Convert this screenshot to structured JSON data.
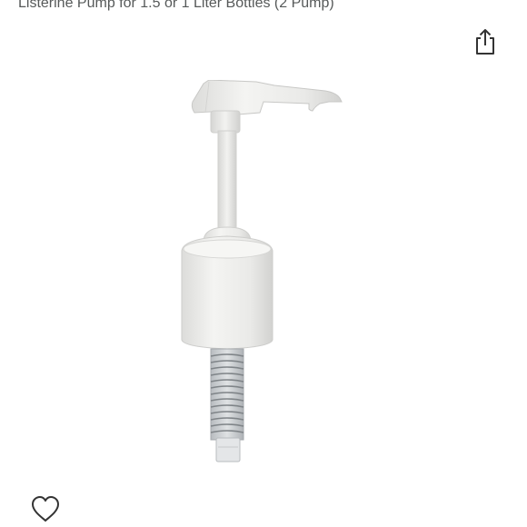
{
  "product": {
    "title": "Listerine Pump for 1.5 or 1 Liter Bottles (2 Pump)"
  },
  "icons": {
    "share": "share-icon",
    "wishlist": "heart-outline-icon"
  },
  "colors": {
    "title_text": "#565959",
    "icon_stroke": "#333333",
    "pump_body": "#ececea",
    "spring": "#9a9ea2"
  }
}
